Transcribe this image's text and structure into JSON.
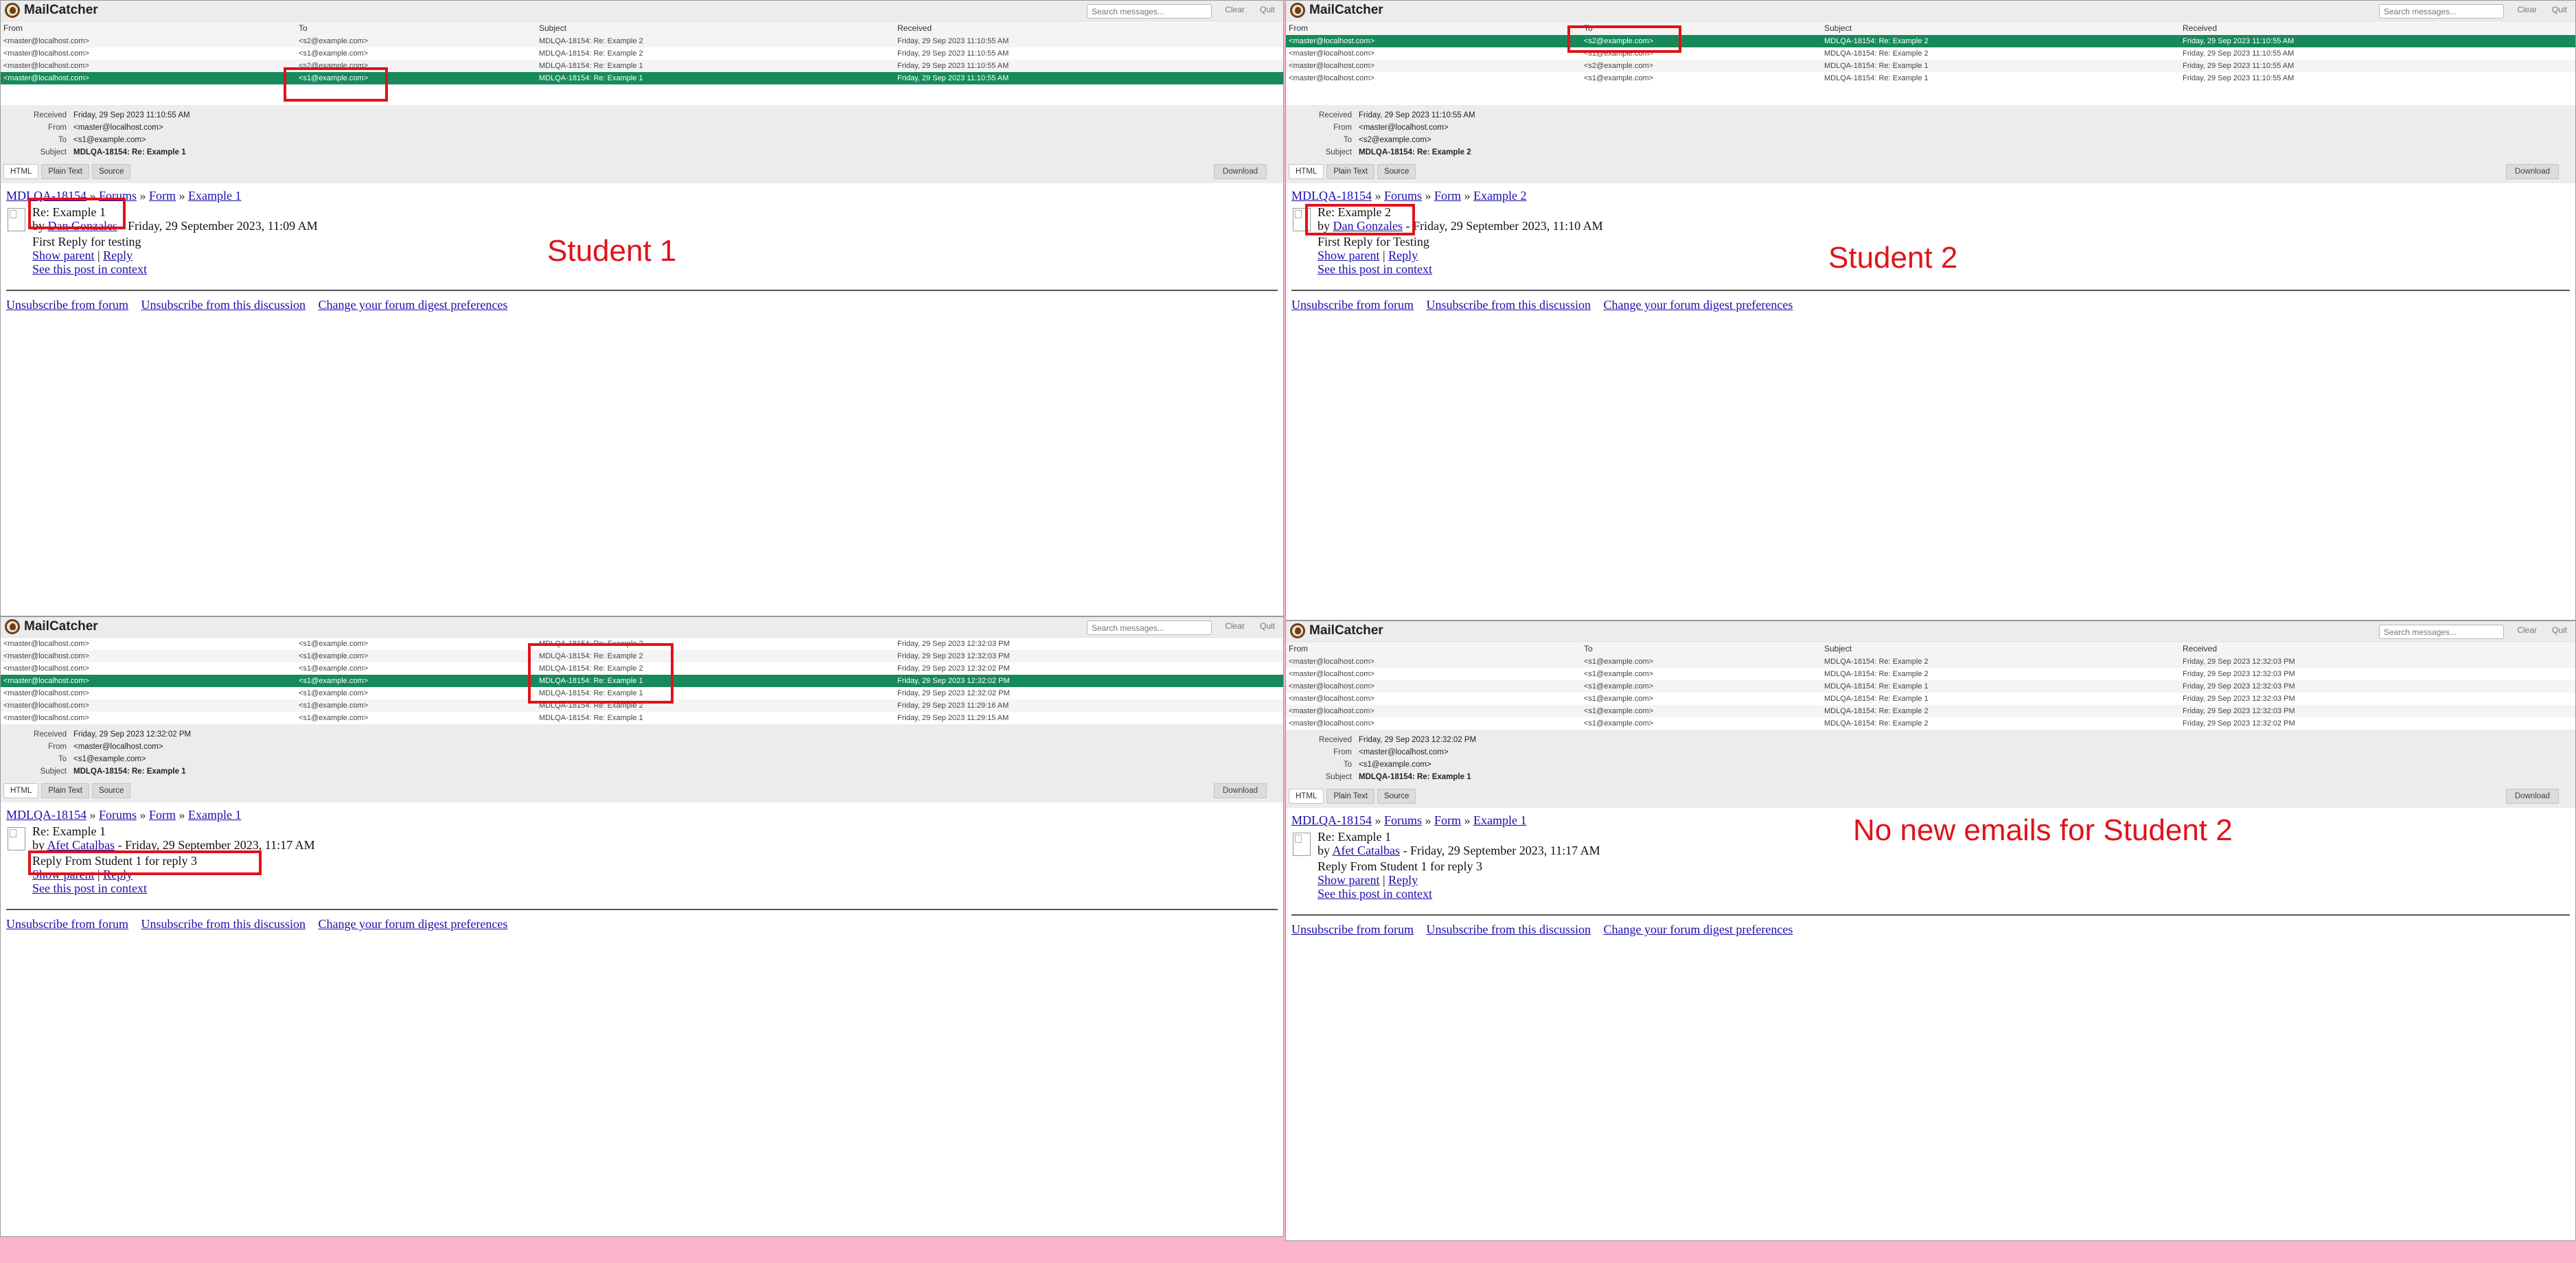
{
  "app": {
    "name": "MailCatcher",
    "search_placeholder": "Search messages...",
    "clear_label": "Clear",
    "quit_label": "Quit",
    "columns": {
      "from": "From",
      "to": "To",
      "subject": "Subject",
      "received": "Received"
    },
    "tabs": {
      "html": "HTML",
      "plain": "Plain Text",
      "source": "Source"
    },
    "download_label": "Download",
    "meta_keys": {
      "received": "Received",
      "from": "From",
      "to": "To",
      "subject": "Subject"
    },
    "footer": {
      "unsub_forum": "Unsubscribe from forum",
      "unsub_discussion": "Unsubscribe from this discussion",
      "digest": "Change your forum digest preferences"
    },
    "links": {
      "show_parent": "Show parent",
      "reply": "Reply",
      "context": "See this post in context",
      "forums": "Forums",
      "form": "Form"
    }
  },
  "panes": {
    "tl": {
      "annotation": "Student 1",
      "rows": [
        {
          "from": "<master@localhost.com>",
          "to": "<s2@example.com>",
          "subject": "MDLQA-18154: Re: Example 2",
          "received": "Friday, 29 Sep 2023 11:10:55 AM"
        },
        {
          "from": "<master@localhost.com>",
          "to": "<s1@example.com>",
          "subject": "MDLQA-18154: Re: Example 2",
          "received": "Friday, 29 Sep 2023 11:10:55 AM"
        },
        {
          "from": "<master@localhost.com>",
          "to": "<s2@example.com>",
          "subject": "MDLQA-18154: Re: Example 1",
          "received": "Friday, 29 Sep 2023 11:10:55 AM"
        },
        {
          "from": "<master@localhost.com>",
          "to": "<s1@example.com>",
          "subject": "MDLQA-18154: Re: Example 1",
          "received": "Friday, 29 Sep 2023 11:10:55 AM"
        }
      ],
      "meta": {
        "received": "Friday, 29 Sep 2023 11:10:55 AM",
        "from": "<master@localhost.com>",
        "to": "<s1@example.com>",
        "subject": "MDLQA-18154: Re: Example 1"
      },
      "crumb_course": "MDLQA-18154",
      "crumb_discussion": "Example 1",
      "post_title": "Re: Example 1",
      "by": "by",
      "author": "Dan Gonzales",
      "date": " - Friday, 29 September 2023, 11:09 AM",
      "message": "First Reply for testing"
    },
    "tr": {
      "annotation": "Student 2",
      "rows": [
        {
          "from": "<master@localhost.com>",
          "to": "<s2@example.com>",
          "subject": "MDLQA-18154: Re: Example 2",
          "received": "Friday, 29 Sep 2023 11:10:55 AM"
        },
        {
          "from": "<master@localhost.com>",
          "to": "<s1@example.com>",
          "subject": "MDLQA-18154: Re: Example 2",
          "received": "Friday, 29 Sep 2023 11:10:55 AM"
        },
        {
          "from": "<master@localhost.com>",
          "to": "<s2@example.com>",
          "subject": "MDLQA-18154: Re: Example 1",
          "received": "Friday, 29 Sep 2023 11:10:55 AM"
        },
        {
          "from": "<master@localhost.com>",
          "to": "<s1@example.com>",
          "subject": "MDLQA-18154: Re: Example 1",
          "received": "Friday, 29 Sep 2023 11:10:55 AM"
        }
      ],
      "meta": {
        "received": "Friday, 29 Sep 2023 11:10:55 AM",
        "from": "<master@localhost.com>",
        "to": "<s2@example.com>",
        "subject": "MDLQA-18154: Re: Example 2"
      },
      "crumb_course": "MDLQA-18154",
      "crumb_discussion": "Example 2",
      "post_title": "Re: Example 2",
      "by": "by",
      "author": "Dan Gonzales",
      "date": " - Friday, 29 September 2023, 11:10 AM",
      "message": "First Reply for Testing"
    },
    "bl": {
      "rows": [
        {
          "from": "<master@localhost.com>",
          "to": "<s1@example.com>",
          "subject": "MDLQA-18154: Re: Example 2",
          "received": "Friday, 29 Sep 2023 12:32:03 PM"
        },
        {
          "from": "<master@localhost.com>",
          "to": "<s1@example.com>",
          "subject": "MDLQA-18154: Re: Example 2",
          "received": "Friday, 29 Sep 2023 12:32:03 PM"
        },
        {
          "from": "<master@localhost.com>",
          "to": "<s1@example.com>",
          "subject": "MDLQA-18154: Re: Example 2",
          "received": "Friday, 29 Sep 2023 12:32:02 PM"
        },
        {
          "from": "<master@localhost.com>",
          "to": "<s1@example.com>",
          "subject": "MDLQA-18154: Re: Example 1",
          "received": "Friday, 29 Sep 2023 12:32:02 PM"
        },
        {
          "from": "<master@localhost.com>",
          "to": "<s1@example.com>",
          "subject": "MDLQA-18154: Re: Example 1",
          "received": "Friday, 29 Sep 2023 12:32:02 PM"
        },
        {
          "from": "<master@localhost.com>",
          "to": "<s1@example.com>",
          "subject": "MDLQA-18154: Re: Example 2",
          "received": "Friday, 29 Sep 2023 11:29:16 AM"
        },
        {
          "from": "<master@localhost.com>",
          "to": "<s1@example.com>",
          "subject": "MDLQA-18154: Re: Example 1",
          "received": "Friday, 29 Sep 2023 11:29:15 AM"
        }
      ],
      "meta": {
        "received": "Friday, 29 Sep 2023 12:32:02 PM",
        "from": "<master@localhost.com>",
        "to": "<s1@example.com>",
        "subject": "MDLQA-18154: Re: Example 1"
      },
      "crumb_course": "MDLQA-18154",
      "crumb_discussion": "Example 1",
      "post_title": "Re: Example 1",
      "by": "by",
      "author": "Afet Catalbas",
      "date": " - Friday, 29 September 2023, 11:17 AM",
      "message": "Reply From Student 1 for reply 3"
    },
    "br": {
      "annotation": "No new emails for Student 2",
      "rows": [
        {
          "from": "<master@localhost.com>",
          "to": "<s1@example.com>",
          "subject": "MDLQA-18154: Re: Example 2",
          "received": "Friday, 29 Sep 2023 12:32:03 PM"
        },
        {
          "from": "<master@localhost.com>",
          "to": "<s1@example.com>",
          "subject": "MDLQA-18154: Re: Example 2",
          "received": "Friday, 29 Sep 2023 12:32:03 PM"
        },
        {
          "from": "<master@localhost.com>",
          "to": "<s1@example.com>",
          "subject": "MDLQA-18154: Re: Example 1",
          "received": "Friday, 29 Sep 2023 12:32:03 PM"
        },
        {
          "from": "<master@localhost.com>",
          "to": "<s1@example.com>",
          "subject": "MDLQA-18154: Re: Example 1",
          "received": "Friday, 29 Sep 2023 12:32:03 PM"
        },
        {
          "from": "<master@localhost.com>",
          "to": "<s1@example.com>",
          "subject": "MDLQA-18154: Re: Example 2",
          "received": "Friday, 29 Sep 2023 12:32:03 PM"
        },
        {
          "from": "<master@localhost.com>",
          "to": "<s1@example.com>",
          "subject": "MDLQA-18154: Re: Example 2",
          "received": "Friday, 29 Sep 2023 12:32:02 PM"
        }
      ],
      "meta": {
        "received": "Friday, 29 Sep 2023 12:32:02 PM",
        "from": "<master@localhost.com>",
        "to": "<s1@example.com>",
        "subject": "MDLQA-18154: Re: Example 1"
      },
      "crumb_course": "MDLQA-18154",
      "crumb_discussion": "Example 1",
      "post_title": "Re: Example 1",
      "by": "by",
      "author": "Afet Catalbas",
      "date": " - Friday, 29 September 2023, 11:17 AM",
      "message": "Reply From Student 1 for reply 3"
    }
  },
  "colors": {
    "selected_row": "#168a5a",
    "annotation_red": "#e0131a",
    "background_pink": "#f9b4cc",
    "link_blue": "#1a0dab"
  }
}
